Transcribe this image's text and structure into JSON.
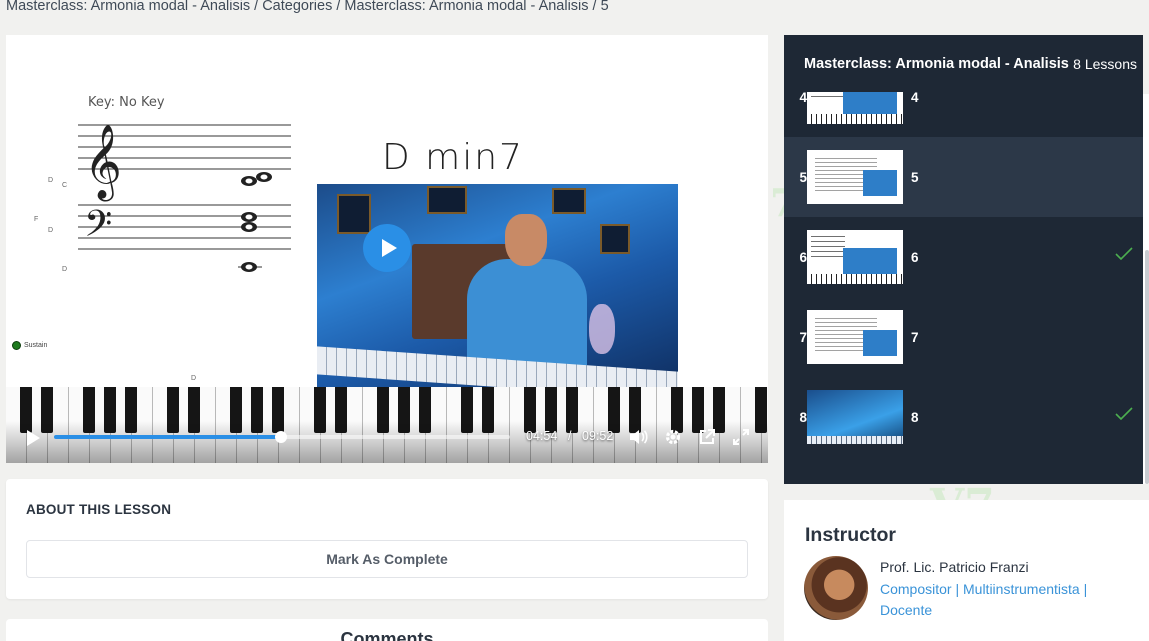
{
  "breadcrumb": {
    "items": [
      "Masterclass: Armonia modal - Analisis",
      "Categories",
      "Masterclass: Armonia modal - Analisis",
      "5"
    ],
    "separator": "/"
  },
  "player": {
    "score": {
      "key_label": "Key: No Key",
      "chord_name": "D min7",
      "sustain_label": "Sustain",
      "side_notes": [
        "D",
        "C",
        "F",
        "D",
        "D"
      ],
      "bottom_note": "D"
    },
    "current_time": "04:54",
    "time_separator": "/",
    "duration": "09:52",
    "progress_fraction": 0.497
  },
  "about": {
    "heading": "ABOUT THIS LESSON",
    "mark_complete_label": "Mark As Complete"
  },
  "comments": {
    "heading": "Comments"
  },
  "playlist": {
    "title": "Masterclass: Armonia modal - Analisis",
    "count": "8 Lessons",
    "items": [
      {
        "num": "4",
        "label": "4",
        "thumb": "staff-cam",
        "completed": false,
        "active": false
      },
      {
        "num": "5",
        "label": "5",
        "thumb": "sheet-cam",
        "completed": false,
        "active": true
      },
      {
        "num": "6",
        "label": "6",
        "thumb": "staff-cam",
        "completed": true,
        "active": false
      },
      {
        "num": "7",
        "label": "7",
        "thumb": "sheet-cam",
        "completed": false,
        "active": false
      },
      {
        "num": "8",
        "label": "8",
        "thumb": "full-cam",
        "completed": true,
        "active": false
      }
    ],
    "check_color": "#4caf50"
  },
  "instructor": {
    "heading": "Instructor",
    "name": "Prof. Lic. Patricio Franzi",
    "role": "Compositor | Multiinstrumentista | Docente"
  },
  "colors": {
    "accent": "#2a8fe6",
    "sidebar_bg": "#1e2835",
    "link": "#3a93d8"
  }
}
